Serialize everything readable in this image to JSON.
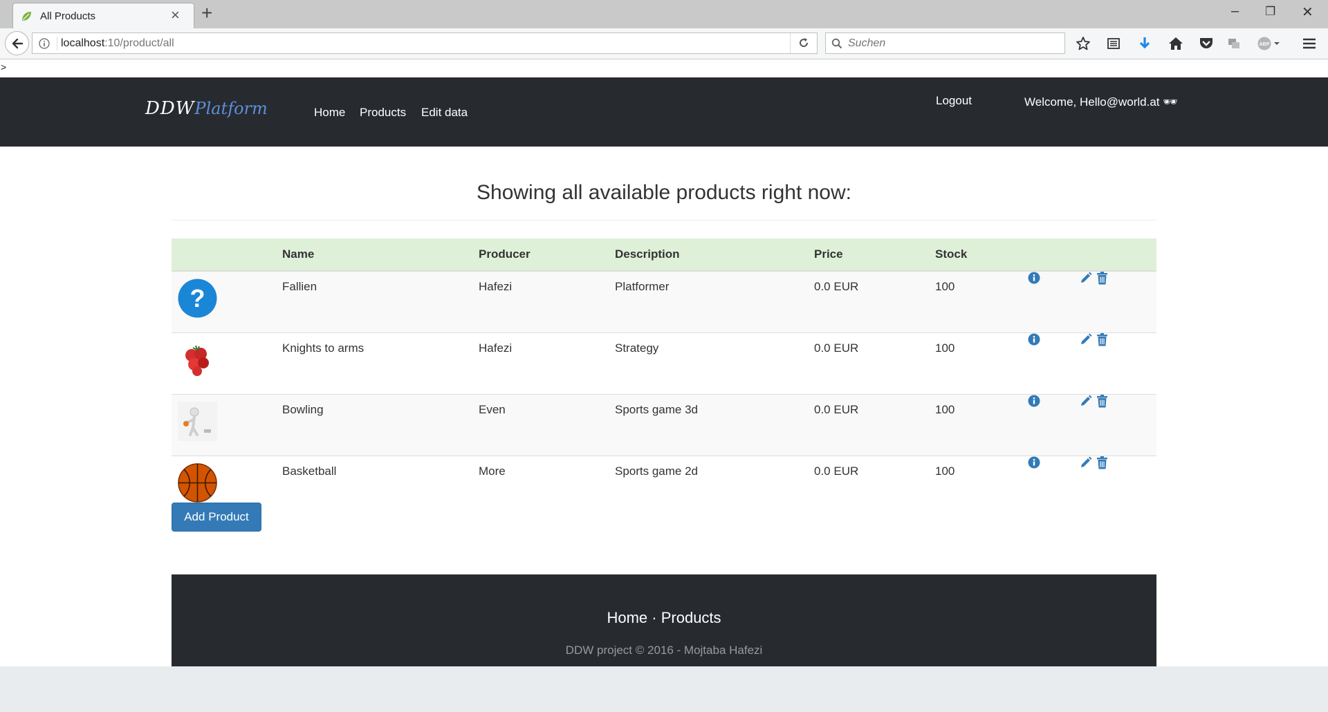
{
  "browser": {
    "tab_title": "All Products",
    "url_host": "localhost",
    "url_path": ":10/product/all",
    "search_placeholder": "Suchen",
    "prompt_text": ">"
  },
  "site": {
    "logo_part1": "DDW",
    "logo_part2": "Platform",
    "nav": [
      "Home",
      "Products",
      "Edit data"
    ],
    "logout": "Logout",
    "welcome": "Welcome, Hello@world.at 🕶"
  },
  "main": {
    "heading": "Showing all available products right now:",
    "columns": [
      "",
      "Name",
      "Producer",
      "Description",
      "Price",
      "Stock",
      "",
      ""
    ],
    "products": [
      {
        "icon": "question-mark-icon",
        "name": "Fallien",
        "producer": "Hafezi",
        "description": "Platformer",
        "price": "0.0 EUR",
        "stock": "100"
      },
      {
        "icon": "tomatoes-icon",
        "name": "Knights to arms",
        "producer": "Hafezi",
        "description": "Strategy",
        "price": "0.0 EUR",
        "stock": "100"
      },
      {
        "icon": "bowling-figure-icon",
        "name": "Bowling",
        "producer": "Even",
        "description": "Sports game 3d",
        "price": "0.0 EUR",
        "stock": "100"
      },
      {
        "icon": "basketball-icon",
        "name": "Basketball",
        "producer": "More",
        "description": "Sports game 2d",
        "price": "0.0 EUR",
        "stock": "100"
      }
    ],
    "add_button": "Add Product"
  },
  "footer": {
    "link_home": "Home",
    "separator": "·",
    "link_products": "Products",
    "copyright": "DDW project © 2016 - Mojtaba Hafezi"
  },
  "colors": {
    "navbar": "#272b30",
    "table_header": "#dff0d8",
    "primary": "#337ab7",
    "page_bottom": "#e9ecef"
  }
}
